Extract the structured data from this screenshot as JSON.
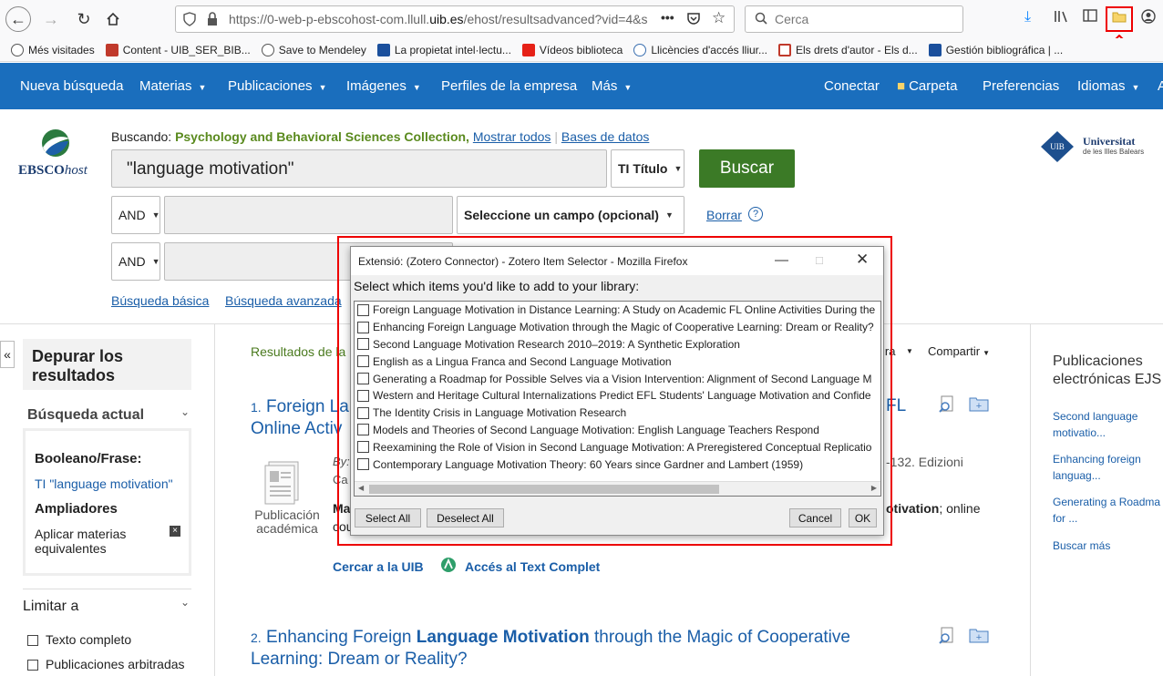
{
  "browser": {
    "url_prefix": "https://0-web-p-ebscohost-com.llull.",
    "url_domain": "uib.es",
    "url_suffix": "/ehost/resultsadvanced?vid=4&si",
    "search_placeholder": "Cerca"
  },
  "bookmarks": [
    {
      "label": "Més visitades",
      "icon": "gear-icon",
      "color": "#555555"
    },
    {
      "label": "Content - UIB_SER_BIB...",
      "icon": "ib-icon",
      "color": "#c0392b"
    },
    {
      "label": "Save to Mendeley",
      "icon": "globe-icon",
      "color": "#555555"
    },
    {
      "label": "La propietat intel·lectu...",
      "icon": "uoc-icon",
      "color": "#1a4f9c"
    },
    {
      "label": "Vídeos biblioteca",
      "icon": "youtube-icon",
      "color": "#e62117"
    },
    {
      "label": "Llicències d'accés lliur...",
      "icon": "globe-icon",
      "color": "#3a6fb0"
    },
    {
      "label": "Els drets d'autor - Els d...",
      "icon": "square-icon",
      "color": "#c0392b"
    },
    {
      "label": "Gestión bibliográfica | ...",
      "icon": "uoc-icon",
      "color": "#1a4f9c"
    }
  ],
  "appnav": {
    "items": [
      "Nueva búsqueda",
      "Materias",
      "Publicaciones",
      "Imágenes",
      "Perfiles de la empresa",
      "Más"
    ],
    "right": [
      "Conectar",
      "Carpeta",
      "Preferencias",
      "Idiomas"
    ],
    "brand_color": "#1a6ebd"
  },
  "search": {
    "searching_label": "Buscando:",
    "database": "Psychology and Behavioral Sciences Collection,",
    "show_all": "Mostrar todos",
    "databases": "Bases de datos",
    "query": "\"language motivation\"",
    "field1": "TI Título",
    "buscar": "Buscar",
    "bool1": "AND",
    "bool2": "AND",
    "field_placeholder": "Seleccione un campo (opcional)",
    "clear": "Borrar",
    "basic": "Búsqueda básica",
    "advanced": "Búsqueda avanzada"
  },
  "logo": {
    "ebsco": "EBSCO",
    "host": "host",
    "uni": "Universitat",
    "uni_sub": "de les Illes Balears"
  },
  "sidebar": {
    "refine": "Depurar los resultados",
    "current_search": "Búsqueda actual",
    "bool_phrase": "Booleano/Frase:",
    "query_link": "TI \"language motivation\"",
    "expanders": "Ampliadores",
    "apply_subjects": "Aplicar materias equivalentes",
    "limit": "Limitar a",
    "full_text": "Texto completo",
    "peer": "Publicaciones arbitradas"
  },
  "results": {
    "label": "Resultados de la",
    "share": "Compartir",
    "r1_num": "1.",
    "r1_a": "Foreign La",
    "r1_b": "Online Activ",
    "r1_tail": "FL",
    "r1_by": "By:",
    "r1_ca": "Ca",
    "r1_pages": "-132. Edizioni",
    "r1_ma": "Ma",
    "r1_cou": "cou",
    "r1_motivation": "otivation",
    "r1_online": "; online",
    "doc_type": "Publicación académica",
    "cercar": "Cercar a la UIB",
    "acces": "Accés al Text Complet",
    "r2_num": "2.",
    "r2_a": "Enhancing Foreign ",
    "r2_bold": "Language Motivation",
    "r2_b": " through the Magic of Cooperative",
    "r2_c": "Learning: Dream or Reality?"
  },
  "right_panel": {
    "title": "Publicaciones electrónicas EJS",
    "links": [
      "Second language motivatio...",
      "Enhancing foreign languag...",
      "Generating a Roadma for ...",
      "Buscar más"
    ]
  },
  "dialog": {
    "title": "Extensió: (Zotero Connector) - Zotero Item Selector - Mozilla Firefox",
    "prompt": "Select which items you'd like to add to your library:",
    "items": [
      "Foreign Language Motivation in Distance Learning: A Study on Academic FL Online Activities During the",
      "Enhancing Foreign Language Motivation through the Magic of Cooperative Learning: Dream or Reality?",
      "Second Language Motivation Research 2010–2019: A Synthetic Exploration",
      "English as a Lingua Franca and Second Language Motivation",
      "Generating a Roadmap for Possible Selves via a Vision Intervention: Alignment of Second Language M",
      "Western and Heritage Cultural Internalizations Predict EFL Students' Language Motivation and Confide",
      "The Identity Crisis in Language Motivation Research",
      "Models and Theories of Second Language Motivation: English Language Teachers Respond",
      "Reexamining the Role of Vision in Second Language Motivation: A Preregistered Conceptual Replicatio",
      "Contemporary Language Motivation Theory: 60 Years since Gardner and Lambert (1959)"
    ],
    "select_all": "Select All",
    "deselect_all": "Deselect All",
    "cancel": "Cancel",
    "ok": "OK"
  }
}
